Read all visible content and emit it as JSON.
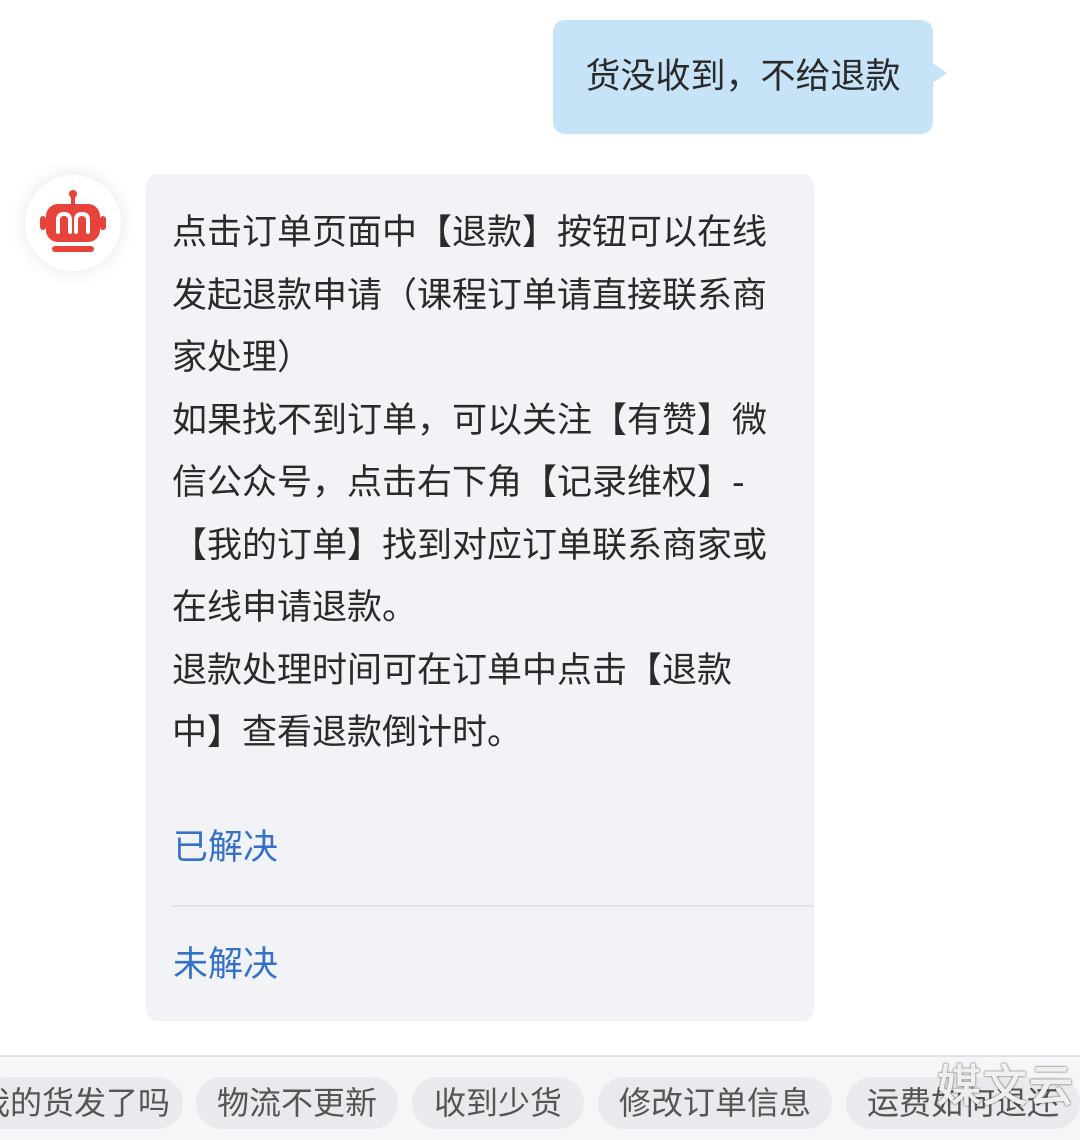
{
  "user_message": {
    "text": "货没收到，不给退款",
    "bubble_color": "#c7e3f8"
  },
  "bot": {
    "avatar_icon": "robot-icon",
    "avatar_color": "#e8433a",
    "bubble_color": "#f2f3f7",
    "paragraphs": [
      "点击订单页面中【退款】按钮可以在线发起退款申请（课程订单请直接联系商家处理）",
      "如果找不到订单，可以关注【有赞】微信公众号，点击右下角【记录维权】-【我的订单】找到对应订单联系商家或在线申请退款。",
      "退款处理时间可在订单中点击【退款中】查看退款倒计时。"
    ],
    "actions": {
      "resolved": "已解决",
      "unresolved": "未解决"
    },
    "action_color": "#3571c9"
  },
  "quick_replies": [
    "我的货发了吗",
    "物流不更新",
    "收到少货",
    "修改订单信息",
    "运费如何退还"
  ],
  "watermark": "媒文云"
}
